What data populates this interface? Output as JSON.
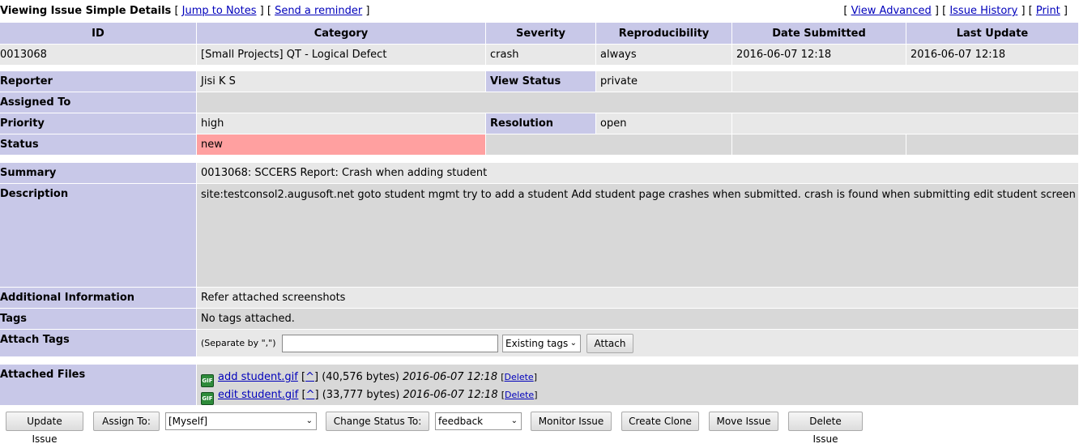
{
  "header": {
    "title": "Viewing Issue Simple Details",
    "left_links": [
      "Jump to Notes",
      "Send a reminder"
    ],
    "right_links": [
      "View Advanced",
      "Issue History",
      "Print"
    ]
  },
  "overview": {
    "columns": [
      "ID",
      "Category",
      "Severity",
      "Reproducibility",
      "Date Submitted",
      "Last Update"
    ],
    "values": [
      "0013068",
      "[Small Projects] QT - Logical Defect",
      "crash",
      "always",
      "2016-06-07 12:18",
      "2016-06-07 12:18"
    ]
  },
  "details": {
    "reporter_label": "Reporter",
    "reporter": "Jisi K S",
    "view_status_label": "View Status",
    "view_status": "private",
    "assigned_to_label": "Assigned To",
    "assigned_to": "",
    "priority_label": "Priority",
    "priority": "high",
    "resolution_label": "Resolution",
    "resolution": "open",
    "status_label": "Status",
    "status": "new",
    "status_color": "#ffa0a0"
  },
  "content": {
    "summary_label": "Summary",
    "summary": "0013068: SCCERS Report: Crash when adding student",
    "description_label": "Description",
    "description": "site:testconsol2.augusoft.net\n\ngoto student mgmt\ntry to add a student\nAdd student page crashes when submitted.\n\ncrash is found when submitting edit student screen also",
    "additional_label": "Additional Information",
    "additional": "Refer attached screenshots",
    "tags_label": "Tags",
    "tags": "No tags attached.",
    "attach_tags_label": "Attach Tags",
    "attach_hint": "(Separate by \",\")",
    "attach_input_value": "",
    "existing_tags": "Existing tags",
    "attach_button": "Attach",
    "files_label": "Attached Files",
    "files": [
      {
        "name": "add student.gif",
        "caret": "^",
        "size": "(40,576 bytes)",
        "date": "2016-06-07 12:18",
        "delete": "Delete"
      },
      {
        "name": "edit student.gif",
        "caret": "^",
        "size": "(33,777 bytes)",
        "date": "2016-06-07 12:18",
        "delete": "Delete"
      }
    ]
  },
  "actions": {
    "update": "Update Issue",
    "assign_to": "Assign To:",
    "assign_select": "[Myself]",
    "change_status": "Change Status To:",
    "status_select": "feedback",
    "monitor": "Monitor Issue",
    "clone": "Create Clone",
    "move": "Move Issue",
    "delete": "Delete Issue"
  },
  "colors": {
    "header_bg": "#c8c8e8",
    "cell_bg": "#e8e8e8",
    "cell_alt_bg": "#d8d8d8",
    "link": "#0000bb"
  }
}
